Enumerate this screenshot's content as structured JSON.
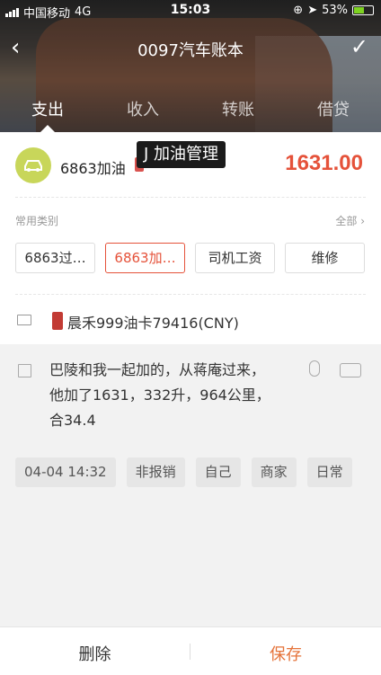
{
  "status_bar": {
    "carrier": "中国移动",
    "network": "4G",
    "time": "15:03",
    "battery": "53%"
  },
  "nav": {
    "title": "0097汽车账本"
  },
  "tabs": [
    {
      "label": "支出",
      "active": true
    },
    {
      "label": "收入",
      "active": false
    },
    {
      "label": "转账",
      "active": false
    },
    {
      "label": "借贷",
      "active": false
    }
  ],
  "entry": {
    "category": "6863加油",
    "toast": "J 加油管理",
    "amount": "1631.00",
    "amount_color": "#e5523a"
  },
  "common": {
    "label": "常用类别",
    "all_label": "全部 ›",
    "chips": [
      {
        "label": "6863过…",
        "active": false
      },
      {
        "label": "6863加…",
        "active": true
      },
      {
        "label": "司机工资",
        "active": false
      },
      {
        "label": "维修",
        "active": false
      }
    ]
  },
  "account": {
    "name": "晨禾999油卡79416(CNY)"
  },
  "note": {
    "line1": "巴陵和我一起加的，从蒋庵过来，",
    "line2": "他加了1631，332升，964公里，",
    "line3": "合34.4"
  },
  "tags": [
    {
      "label": "04-04 14:32"
    },
    {
      "label": "非报销"
    },
    {
      "label": "自己"
    },
    {
      "label": "商家"
    },
    {
      "label": "日常"
    }
  ],
  "footer": {
    "delete_label": "删除",
    "save_label": "保存"
  },
  "colors": {
    "accent": "#e5523a",
    "save": "#e5733a",
    "category_icon_bg": "#c8d65a"
  }
}
